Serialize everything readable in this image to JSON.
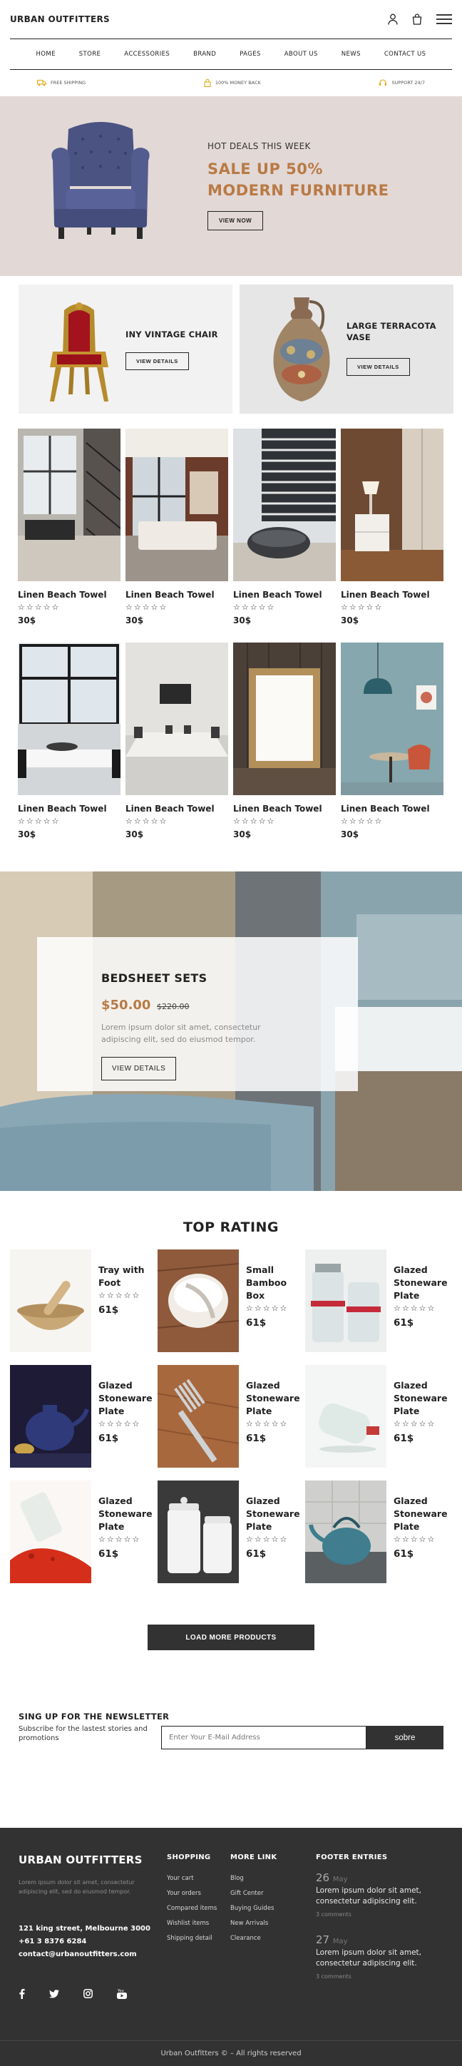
{
  "header": {
    "brand": "URBAN OUTFITTERS",
    "icons": [
      "user-icon",
      "bag-icon",
      "menu-icon"
    ]
  },
  "nav": [
    "HOME",
    "STORE",
    "ACCESSORIES",
    "BRAND",
    "PAGES",
    "ABOUT US",
    "NEWS",
    "CONTACT US"
  ],
  "features": [
    {
      "icon": "truck-icon",
      "label": "FREE SHIPPING"
    },
    {
      "icon": "lock-icon",
      "label": "100% MONEY BACK"
    },
    {
      "icon": "headset-icon",
      "label": "SUPPORT 24/7"
    }
  ],
  "hero": {
    "kicker": "HOT DEALS THIS WEEK",
    "title_line1": "SALE UP 50%",
    "title_line2": "MODERN FURNITURE",
    "button": "VIEW NOW",
    "accent": "#b97a45",
    "background": "#e2d8d6"
  },
  "promos": [
    {
      "title": "INY VINTAGE CHAIR",
      "button": "VIEW DETAILS"
    },
    {
      "title": "LARGE TERRACOTA VASE",
      "button": "VIEW DETAILS"
    }
  ],
  "products": [
    {
      "name": "Linen Beach Towel",
      "stars": "☆☆☆☆☆",
      "price": "30$"
    },
    {
      "name": "Linen Beach Towel",
      "stars": "☆☆☆☆☆",
      "price": "30$"
    },
    {
      "name": "Linen Beach Towel",
      "stars": "☆☆☆☆☆",
      "price": "30$"
    },
    {
      "name": "Linen Beach Towel",
      "stars": "☆☆☆☆☆",
      "price": "30$"
    },
    {
      "name": "Linen Beach Towel",
      "stars": "☆☆☆☆☆",
      "price": "30$"
    },
    {
      "name": "Linen Beach Towel",
      "stars": "☆☆☆☆☆",
      "price": "30$"
    },
    {
      "name": "Linen Beach Towel",
      "stars": "☆☆☆☆☆",
      "price": "30$"
    },
    {
      "name": "Linen Beach Towel",
      "stars": "☆☆☆☆☆",
      "price": "30$"
    }
  ],
  "banner": {
    "title": "BEDSHEET SETS",
    "price": "$50.00",
    "old_price": "$220.00",
    "description": "Lorem ipsum dolor sit amet, consectetur adipiscing elit, sed do eiusmod tempor.",
    "button": "VIEW DETAILS"
  },
  "top_rating": {
    "title": "TOP RATING",
    "items": [
      {
        "name": "Tray with Foot",
        "stars": "☆☆☆☆☆",
        "price": "61$"
      },
      {
        "name": "Small Bamboo Box",
        "stars": "☆☆☆☆☆",
        "price": "61$"
      },
      {
        "name": "Glazed Stoneware Plate",
        "stars": "☆☆☆☆☆",
        "price": "61$"
      },
      {
        "name": "Glazed Stoneware Plate",
        "stars": "☆☆☆☆☆",
        "price": "61$"
      },
      {
        "name": "Glazed Stoneware Plate",
        "stars": "☆☆☆☆☆",
        "price": "61$"
      },
      {
        "name": "Glazed Stoneware Plate",
        "stars": "☆☆☆☆☆",
        "price": "61$"
      },
      {
        "name": "Glazed Stoneware Plate",
        "stars": "☆☆☆☆☆",
        "price": "61$"
      },
      {
        "name": "Glazed Stoneware Plate",
        "stars": "☆☆☆☆☆",
        "price": "61$"
      },
      {
        "name": "Glazed Stoneware Plate",
        "stars": "☆☆☆☆☆",
        "price": "61$"
      }
    ],
    "load_more": "LOAD MORE PRODUCTS"
  },
  "newsletter": {
    "title": "SING UP FOR THE NEWSLETTER",
    "subtitle": "Subscribe for the lastest stories and promotions",
    "placeholder": "Enter Your E-Mail Address",
    "button": "sobre"
  },
  "footer": {
    "brand": "URBAN OUTFITTERS",
    "description": "Lorem ipsum dolor sit amet, consectetur adipiscing elit, sed do eiusmod tempor.",
    "address": "121 king street, Melbourne 3000",
    "phone": "+61 3 8376 6284",
    "email": "contact@urbanoutfitters.com",
    "social_icons": [
      "facebook-icon",
      "twitter-icon",
      "instagram-icon",
      "youtube-icon"
    ],
    "shopping": {
      "title": "SHOPPING",
      "links": [
        "Your cart",
        "Your orders",
        "Compared items",
        "Wishlist items",
        "Shipping detail"
      ]
    },
    "more": {
      "title": "MORE LINK",
      "links": [
        "Blog",
        "Gift Center",
        "Buying Guides",
        "New Arrivals",
        "Clearance"
      ]
    },
    "entries": {
      "title": "FOOTER ENTRIES",
      "items": [
        {
          "day": "26",
          "month": "May",
          "text": "Lorem ipsum dolor sit amet, consectetur adipiscing elit.",
          "comments": "3 comments"
        },
        {
          "day": "27",
          "month": "May",
          "text": "Lorem ipsum dolor sit amet, consectetur adipiscing elit.",
          "comments": "3 comments"
        }
      ]
    },
    "copyright": "Urban Outfitters © – All rights reserved",
    "background": "#323232"
  }
}
